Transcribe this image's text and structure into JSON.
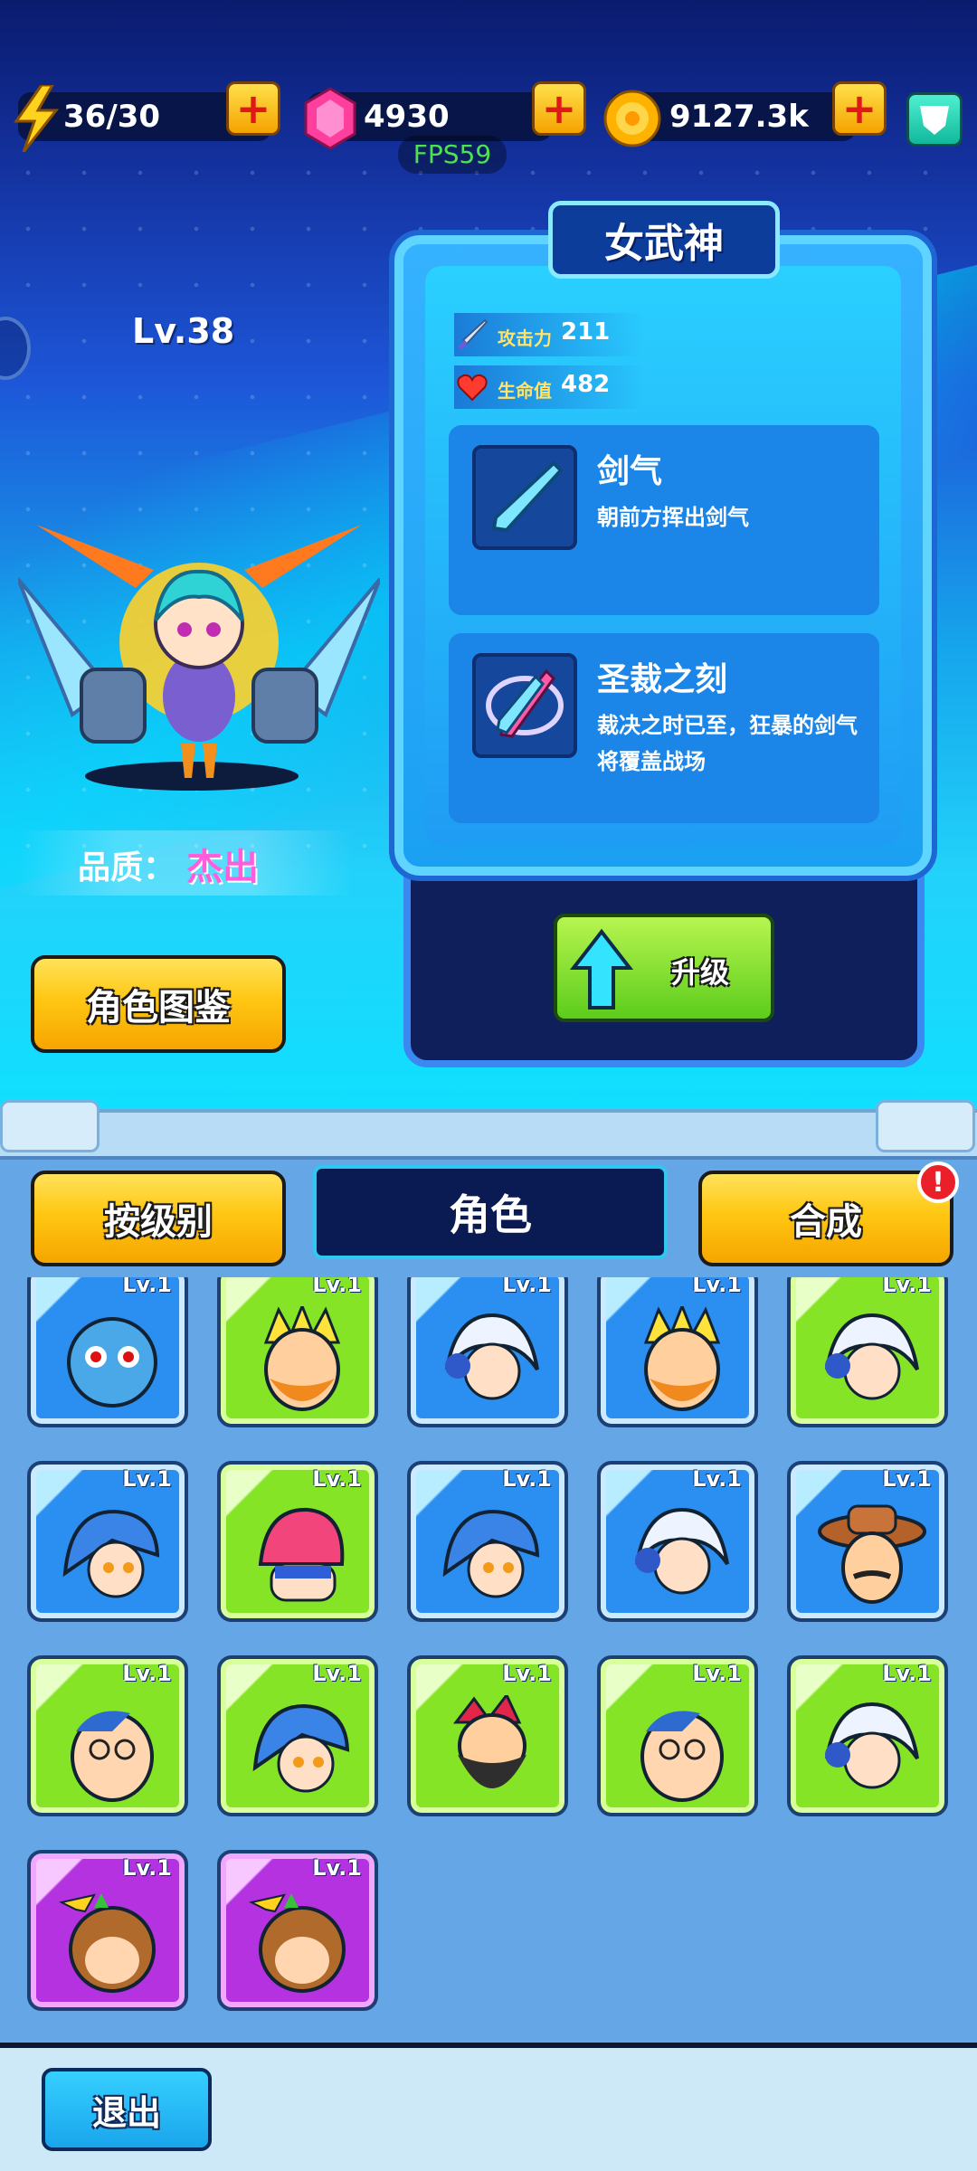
{
  "resources": {
    "energy": "36/30",
    "gems": "4930",
    "gold": "9127.3k",
    "fps": "FPS59"
  },
  "character": {
    "level": "Lv.38",
    "quality_label": "品质：",
    "quality_value": "杰出",
    "name": "女武神",
    "stats": [
      {
        "key": "攻击力",
        "value": "211",
        "icon": "sword-icon"
      },
      {
        "key": "生命值",
        "value": "482",
        "icon": "heart-icon"
      }
    ],
    "skills": [
      {
        "name": "剑气",
        "desc": "朝前方挥出剑气",
        "icon": "sword-slash-icon"
      },
      {
        "name": "圣裁之刻",
        "desc": "裁决之时已至，狂暴的剑气将覆盖战场",
        "icon": "twin-swords-icon"
      }
    ]
  },
  "buttons": {
    "codex": "角色图鉴",
    "upgrade": "升级",
    "sort": "按级别",
    "tab_roles": "角色",
    "merge": "合成",
    "merge_alert": "!",
    "exit": "退出"
  },
  "roster": [
    {
      "level": "Lv.1",
      "rarity": "blue",
      "face": "blue-monster"
    },
    {
      "level": "Lv.1",
      "rarity": "green",
      "face": "spiky-blond-man"
    },
    {
      "level": "Lv.1",
      "rarity": "blue",
      "face": "white-hair-girl"
    },
    {
      "level": "Lv.1",
      "rarity": "blue",
      "face": "spiky-blond-man"
    },
    {
      "level": "Lv.1",
      "rarity": "green",
      "face": "white-hair-girl"
    },
    {
      "level": "Lv.1",
      "rarity": "blue",
      "face": "blue-hair-girl"
    },
    {
      "level": "Lv.1",
      "rarity": "green",
      "face": "pink-hair-girl"
    },
    {
      "level": "Lv.1",
      "rarity": "blue",
      "face": "blue-hair-girl"
    },
    {
      "level": "Lv.1",
      "rarity": "blue",
      "face": "white-hair-girl"
    },
    {
      "level": "Lv.1",
      "rarity": "blue",
      "face": "cowboy"
    },
    {
      "level": "Lv.1",
      "rarity": "green",
      "face": "glasses-man"
    },
    {
      "level": "Lv.1",
      "rarity": "green",
      "face": "blue-hair-girl"
    },
    {
      "level": "Lv.1",
      "rarity": "green",
      "face": "bearded-man"
    },
    {
      "level": "Lv.1",
      "rarity": "green",
      "face": "glasses-man"
    },
    {
      "level": "Lv.1",
      "rarity": "green",
      "face": "white-hair-girl"
    },
    {
      "level": "Lv.1",
      "rarity": "purple",
      "face": "monkey"
    },
    {
      "level": "Lv.1",
      "rarity": "purple",
      "face": "monkey"
    }
  ]
}
